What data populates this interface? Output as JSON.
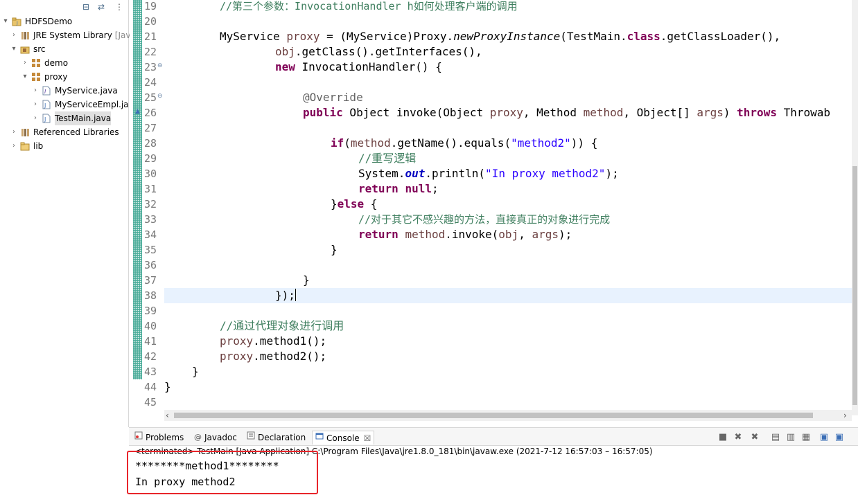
{
  "explorer": {
    "tree": [
      {
        "label": "HDFSDemo",
        "icon": "project-icon",
        "twisty": "▾",
        "depth": 0
      },
      {
        "label": "JRE System Library",
        "suffix": "[Jav",
        "icon": "library-icon",
        "twisty": "›",
        "depth": 1
      },
      {
        "label": "src",
        "icon": "source-folder-icon",
        "twisty": "▾",
        "depth": 1
      },
      {
        "label": "demo",
        "icon": "package-icon",
        "twisty": "›",
        "depth": 2
      },
      {
        "label": "proxy",
        "icon": "package-icon",
        "twisty": "▾",
        "depth": 2
      },
      {
        "label": "MyService.java",
        "icon": "java-interface-icon",
        "twisty": "›",
        "depth": 3
      },
      {
        "label": "MyServiceEmpl.ja",
        "icon": "java-file-icon",
        "twisty": "›",
        "depth": 3
      },
      {
        "label": "TestMain.java",
        "icon": "java-file-icon",
        "twisty": "›",
        "depth": 3,
        "selected": true
      },
      {
        "label": "Referenced Libraries",
        "icon": "library-icon",
        "twisty": "›",
        "depth": 1
      },
      {
        "label": "lib",
        "icon": "folder-icon",
        "twisty": "›",
        "depth": 1
      }
    ]
  },
  "editor": {
    "line_numbers": [
      "19",
      "20",
      "21",
      "22",
      "23",
      "24",
      "25",
      "26",
      "27",
      "28",
      "29",
      "30",
      "31",
      "32",
      "33",
      "34",
      "35",
      "36",
      "37",
      "38",
      "39",
      "40",
      "41",
      "42",
      "43",
      "44",
      "45"
    ],
    "lines": {
      "l19": "//第三个参数：InvocationHandler h如何处理客户端的调用",
      "l21a": "MyService ",
      "l21b": "proxy",
      "l21c": " = (MyService)Proxy.",
      "l21d": "newProxyInstance",
      "l21e": "(TestMain.",
      "l21f": "class",
      "l21g": ".getClassLoader(),",
      "l22a": "obj",
      "l22b": ".getClass().getInterfaces(),",
      "l23a": "new",
      "l23b": " InvocationHandler() {",
      "l25": "@Override",
      "l26a": "public",
      "l26b": " Object invoke(Object ",
      "l26c": "proxy",
      "l26d": ", Method ",
      "l26e": "method",
      "l26f": ", Object[] ",
      "l26g": "args",
      "l26h": ") ",
      "l26i": "throws",
      "l26j": " Throwab",
      "l28a": "if",
      "l28b": "(",
      "l28c": "method",
      "l28d": ".getName().equals(",
      "l28e": "\"method2\"",
      "l28f": ")) {",
      "l29": "//重写逻辑",
      "l30a": "System.",
      "l30b": "out",
      "l30c": ".println(",
      "l30d": "\"In proxy method2\"",
      "l30e": ");",
      "l31a": "return",
      "l31b": "null",
      "l31c": ";",
      "l32a": "}",
      "l32b": "else",
      "l32c": " {",
      "l33": "//对于其它不感兴趣的方法，直接真正的对象进行完成",
      "l34a": "return",
      "l34b": "method",
      "l34c": ".invoke(",
      "l34d": "obj",
      "l34e": ", ",
      "l34f": "args",
      "l34g": ");",
      "l35": "}",
      "l37": "}",
      "l38": "});",
      "l40": "//通过代理对象进行调用",
      "l41a": "proxy",
      "l41b": ".method1();",
      "l42a": "proxy",
      "l42b": ".method2();",
      "l43": "}",
      "l44": "}"
    }
  },
  "panel": {
    "tabs": [
      {
        "label": "Problems",
        "icon": "problems-icon"
      },
      {
        "label": "Javadoc",
        "icon": "javadoc-icon"
      },
      {
        "label": "Declaration",
        "icon": "declaration-icon"
      },
      {
        "label": "Console",
        "icon": "console-icon",
        "active": true
      }
    ],
    "close_glyph": "☒",
    "status": "<terminated> TestMain [Java Application] C:\\Program Files\\Java\\jre1.8.0_181\\bin\\javaw.exe  (2021-7-12 16:57:03 – 16:57:05)",
    "output": [
      "********method1********",
      "In proxy method2"
    ]
  },
  "colors": {
    "highlight_box": "#e8252b",
    "ruler": "#4fae9c",
    "current_line": "#e8f2fe"
  }
}
